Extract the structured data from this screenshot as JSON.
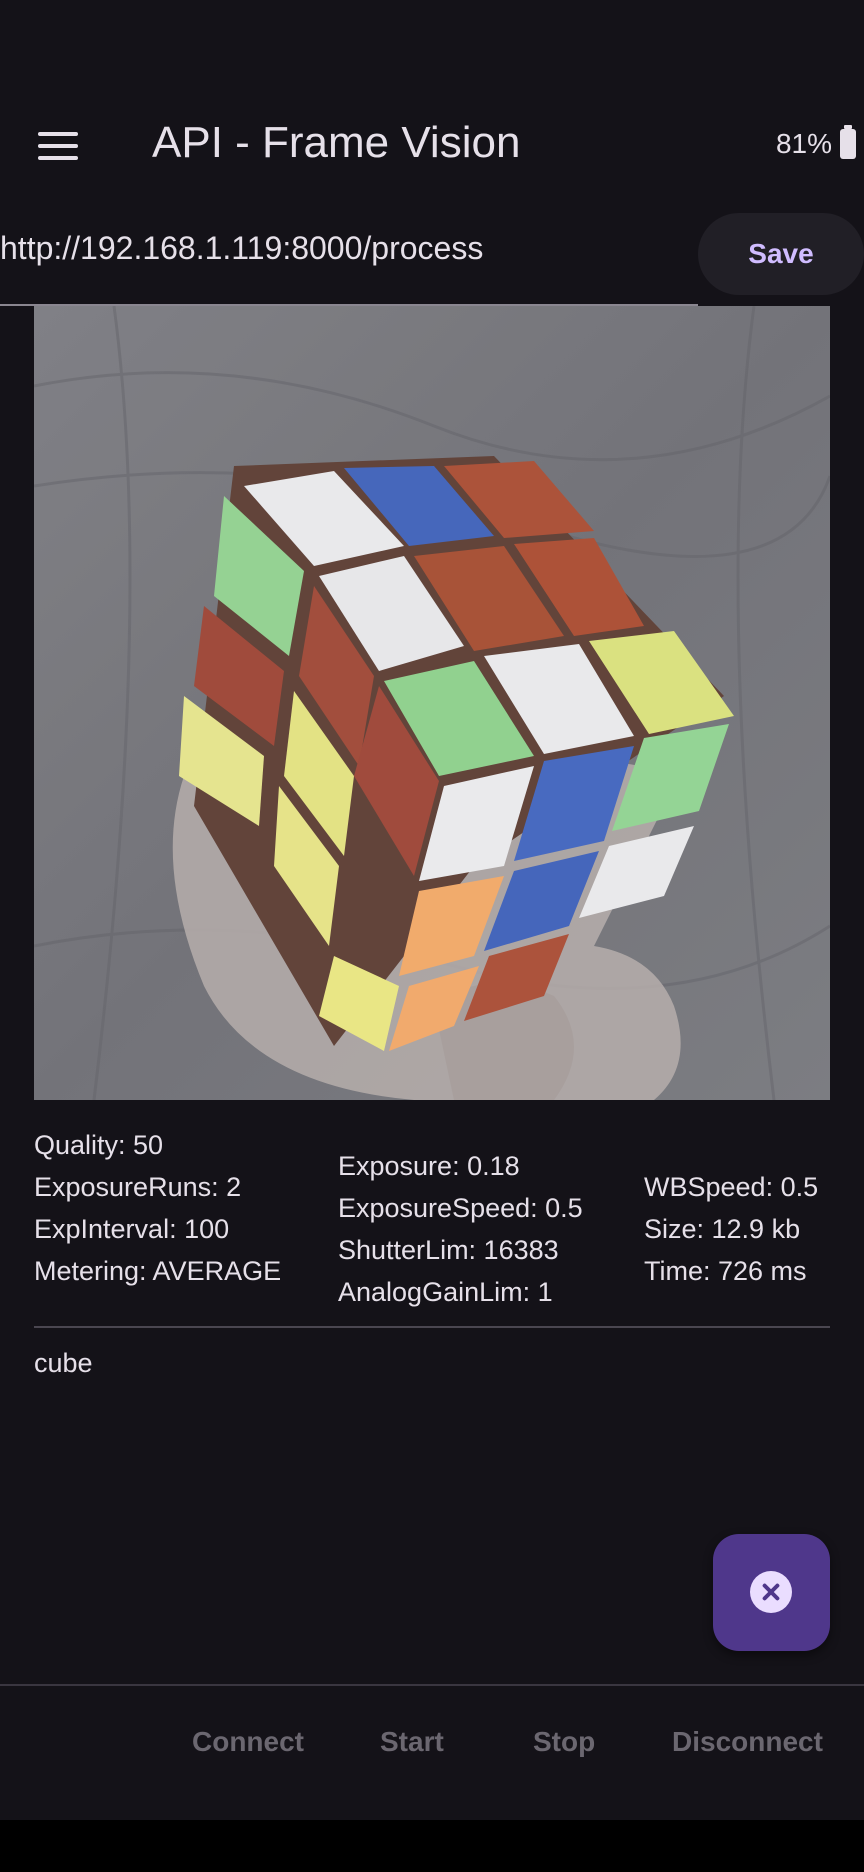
{
  "app": {
    "title": "API - Frame Vision",
    "battery": "81%"
  },
  "url_bar": {
    "value": "http://192.168.1.119:8000/process",
    "save_label": "Save"
  },
  "stats": {
    "col1": [
      "Quality: 50",
      "ExposureRuns: 2",
      "ExpInterval: 100",
      "Metering: AVERAGE"
    ],
    "col2": [
      "Exposure: 0.18",
      "ExposureSpeed: 0.5",
      "ShutterLim: 16383",
      "AnalogGainLim: 1"
    ],
    "col3": [
      "WBSpeed: 0.5",
      "Size: 12.9 kb",
      "Time: 726 ms"
    ]
  },
  "result": "cube",
  "fab_icon": "close-circle-icon",
  "bottom_bar": {
    "connect": "Connect",
    "start": "Start",
    "stop": "Stop",
    "disconnect": "Disconnect"
  },
  "colors": {
    "background": "#141218",
    "accent": "#d0bcff",
    "fab": "#4f378b",
    "disabled_text": "#6b6770"
  }
}
